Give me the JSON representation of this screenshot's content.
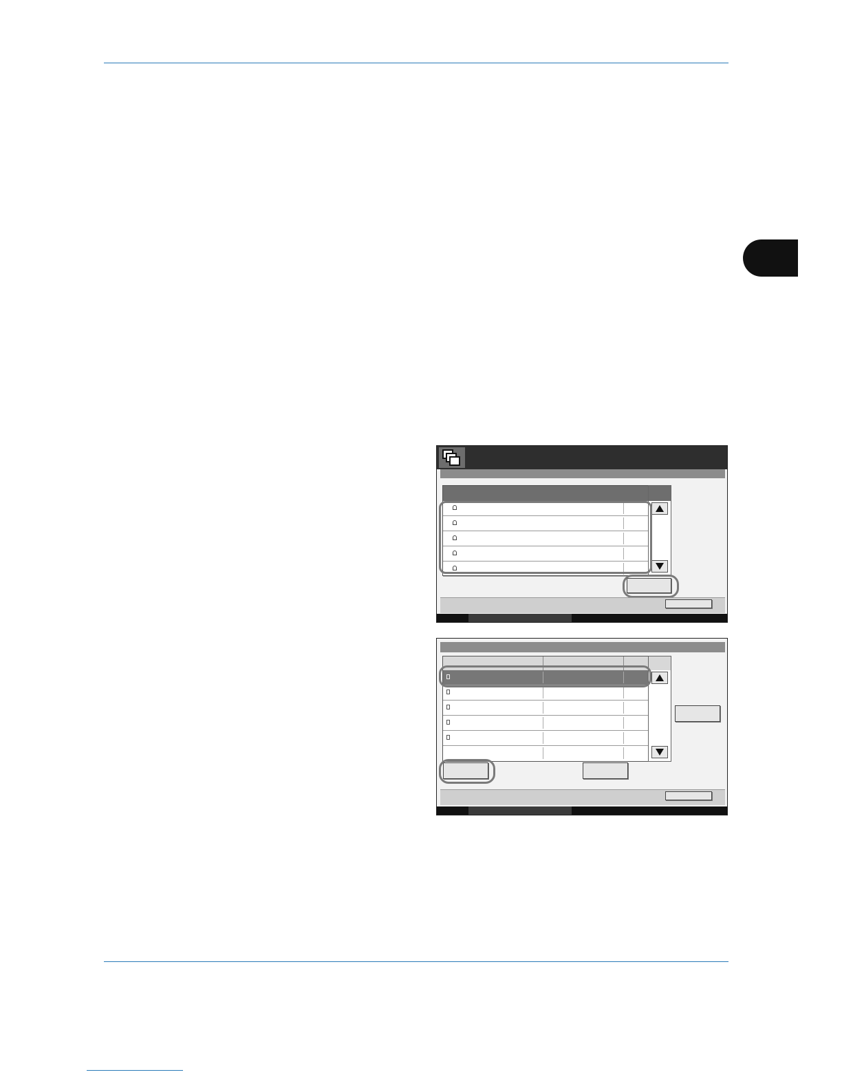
{
  "document": {
    "chapter_tab": "",
    "footer_link": ""
  },
  "panel1": {
    "rows": [
      "",
      "",
      "",
      "",
      ""
    ]
  },
  "panel2": {
    "rows": [
      "",
      "",
      "",
      "",
      "",
      ""
    ]
  }
}
